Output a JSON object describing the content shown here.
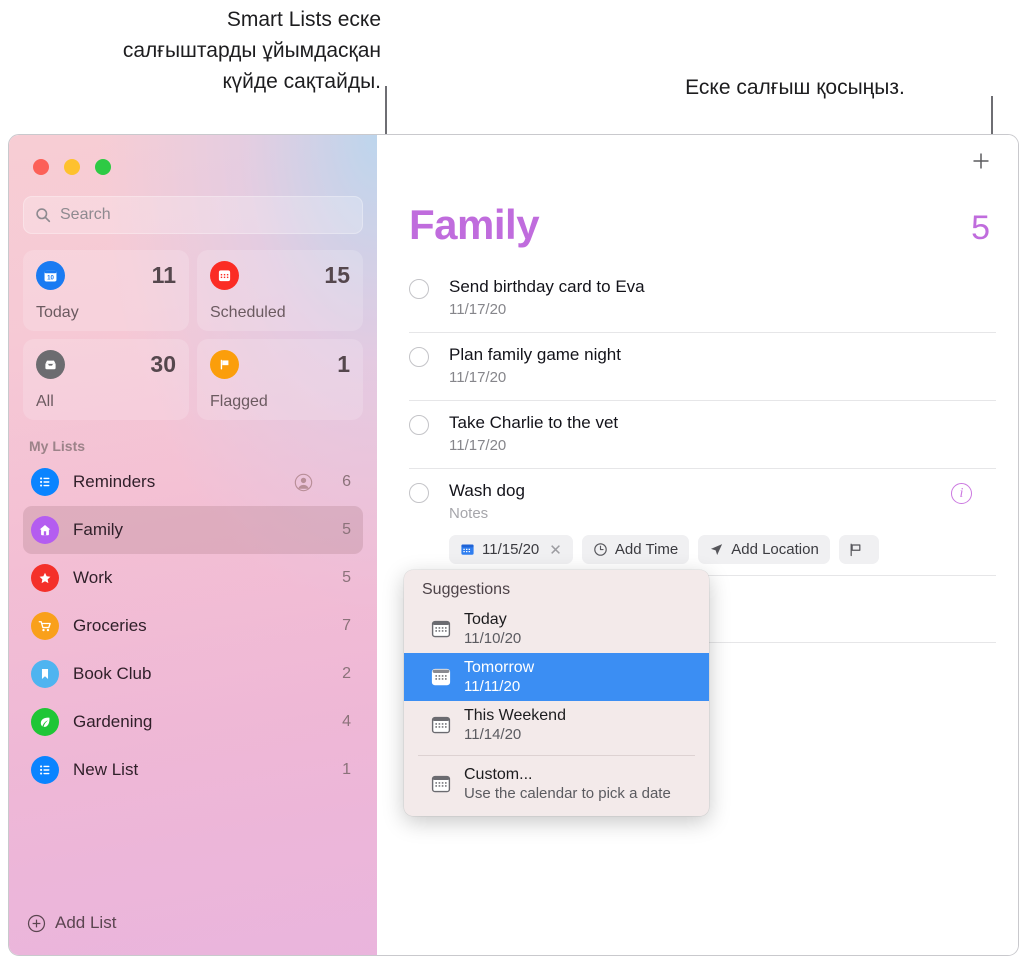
{
  "callouts": {
    "left": "Smart Lists еске\nсалғыштарды ұйымдасқан\nкүйде сақтайды.",
    "right": "Еске салғыш қосыңыз."
  },
  "window": {
    "traffic_lights": [
      "close",
      "minimize",
      "zoom"
    ]
  },
  "sidebar": {
    "search": {
      "placeholder": "Search",
      "value": ""
    },
    "smart_lists": [
      {
        "label": "Today",
        "count": "11",
        "icon": "today-calendar-icon",
        "color": "#1a7bf2"
      },
      {
        "label": "Scheduled",
        "count": "15",
        "icon": "scheduled-calendar-icon",
        "color": "#fb2c24"
      },
      {
        "label": "All",
        "count": "30",
        "icon": "all-inbox-icon",
        "color": "#6c6c70"
      },
      {
        "label": "Flagged",
        "count": "1",
        "icon": "flag-icon",
        "color": "#fb9e0b"
      }
    ],
    "my_lists_header": "My Lists",
    "lists": [
      {
        "name": "Reminders",
        "count": "6",
        "icon": "list-bullet-icon",
        "color": "#0a84ff",
        "shared": true
      },
      {
        "name": "Family",
        "count": "5",
        "icon": "house-icon",
        "color": "#b45df0",
        "shared": false,
        "selected": true
      },
      {
        "name": "Work",
        "count": "5",
        "icon": "star-icon",
        "color": "#f4302a",
        "shared": false
      },
      {
        "name": "Groceries",
        "count": "7",
        "icon": "cart-icon",
        "color": "#f9a01b",
        "shared": false
      },
      {
        "name": "Book Club",
        "count": "2",
        "icon": "bookmark-icon",
        "color": "#4fb4f0",
        "shared": false
      },
      {
        "name": "Gardening",
        "count": "4",
        "icon": "leaf-icon",
        "color": "#1ec636",
        "shared": false
      },
      {
        "name": "New List",
        "count": "1",
        "icon": "list-bullet-icon",
        "color": "#0a84ff",
        "shared": false
      }
    ],
    "add_list_label": "Add List"
  },
  "main": {
    "add_reminder_icon": "plus-icon",
    "title": "Family",
    "title_color": "#c06cdd",
    "total": "5",
    "reminders": [
      {
        "title": "Send birthday card to Eva",
        "sub": "11/17/20"
      },
      {
        "title": "Plan family game night",
        "sub": "11/17/20"
      },
      {
        "title": "Take Charlie to the vet",
        "sub": "11/17/20"
      },
      {
        "title": "Wash dog",
        "notes": "Notes",
        "editing": true
      }
    ],
    "chips": [
      {
        "label": "11/15/20",
        "icon": "calendar-icon",
        "removable": true
      },
      {
        "label": "Add Time",
        "icon": "clock-icon"
      },
      {
        "label": "Add Location",
        "icon": "location-arrow-icon"
      },
      {
        "label": "",
        "icon": "flag-icon"
      }
    ]
  },
  "suggestions": {
    "header": "Suggestions",
    "items": [
      {
        "title": "Today",
        "detail": "11/10/20",
        "icon": "calendar-icon",
        "active": false
      },
      {
        "title": "Tomorrow",
        "detail": "11/11/20",
        "icon": "calendar-icon",
        "active": true
      },
      {
        "title": "This Weekend",
        "detail": "11/14/20",
        "icon": "calendar-icon",
        "active": false
      }
    ],
    "custom": {
      "title": "Custom...",
      "detail": "Use the calendar to pick a date",
      "icon": "calendar-icon"
    }
  }
}
